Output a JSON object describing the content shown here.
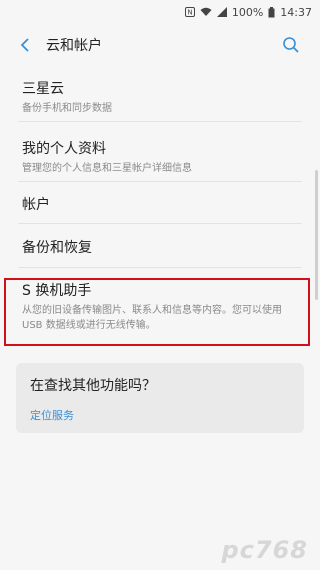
{
  "status": {
    "battery": "100%",
    "time": "14:37"
  },
  "header": {
    "title": "云和帐户"
  },
  "items": [
    {
      "title": "三星云",
      "subtitle": "备份手机和同步数据"
    },
    {
      "title": "我的个人资料",
      "subtitle": "管理您的个人信息和三星帐户详细信息"
    },
    {
      "title": "帐户"
    },
    {
      "title": "备份和恢复"
    },
    {
      "title": "S 换机助手",
      "subtitle": "从您的旧设备传输图片、联系人和信息等内容。您可以使用 USB 数据线或进行无线传输。"
    }
  ],
  "card": {
    "question": "在查找其他功能吗？",
    "link": "定位服务"
  },
  "watermark": "pc768",
  "colors": {
    "accent": "#3a8fd6",
    "highlight": "#d40f1c",
    "background": "#f6f6f6"
  },
  "icons": [
    "nfc-icon",
    "wifi-icon",
    "signal-icon",
    "battery-icon",
    "back-arrow-icon",
    "search-icon"
  ]
}
